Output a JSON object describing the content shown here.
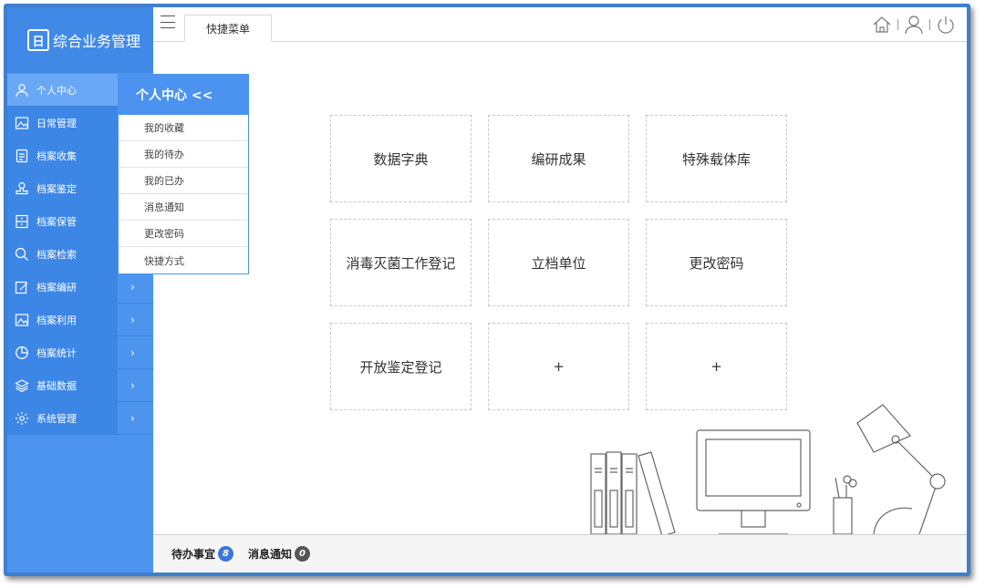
{
  "brand": {
    "logo_glyph": "日",
    "title": "综合业务管理"
  },
  "sidebar": {
    "items": [
      {
        "label": "个人中心",
        "icon": "user-icon",
        "arrow": "",
        "active": true
      },
      {
        "label": "日常管理",
        "icon": "image-icon",
        "arrow": ""
      },
      {
        "label": "档案收集",
        "icon": "document-icon",
        "arrow": ""
      },
      {
        "label": "档案鉴定",
        "icon": "stamp-icon",
        "arrow": ""
      },
      {
        "label": "档案保管",
        "icon": "cabinet-icon",
        "arrow": ""
      },
      {
        "label": "档案检索",
        "icon": "search-icon",
        "arrow": ""
      },
      {
        "label": "档案编研",
        "icon": "edit-icon",
        "arrow": "›"
      },
      {
        "label": "档案利用",
        "icon": "image-icon",
        "arrow": "›"
      },
      {
        "label": "档案统计",
        "icon": "pie-chart-icon",
        "arrow": "›"
      },
      {
        "label": "基础数据",
        "icon": "layers-icon",
        "arrow": "›"
      },
      {
        "label": "系统管理",
        "icon": "gear-icon",
        "arrow": "›"
      }
    ]
  },
  "submenu": {
    "title": "个人中心 <<",
    "items": [
      "我的收藏",
      "我的待办",
      "我的已办",
      "消息通知",
      "更改密码",
      "快捷方式"
    ]
  },
  "topbar": {
    "tab_label": "快捷菜单"
  },
  "shortcuts": [
    "数据字典",
    "编研成果",
    "特殊载体库",
    "消毒灭菌工作登记",
    "立档单位",
    "更改密码",
    "开放鉴定登记",
    "+",
    "+"
  ],
  "footer": {
    "todo_label": "待办事宜",
    "todo_count": "8",
    "notice_label": "消息通知",
    "notice_count": "0"
  },
  "colors": {
    "accent": "#4d94ef",
    "frame": "#3f7fd0"
  }
}
